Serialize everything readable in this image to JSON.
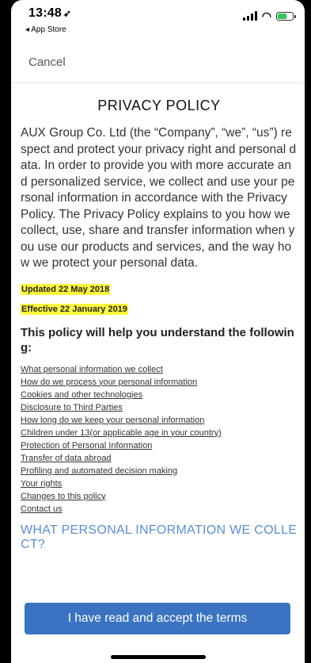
{
  "status_bar": {
    "time": "13:48",
    "location_glyph": "➶",
    "back_app": "◂ App Store",
    "wifi_glyph": "◠"
  },
  "nav": {
    "cancel_label": "Cancel"
  },
  "policy": {
    "title": "PRIVACY POLICY",
    "intro": "AUX Group Co. Ltd (the “Company”, “we”, “us”) respect and protect your privacy right and personal data. In order to provide you with more accurate and personalized service, we collect and use your personal information in accordance with the Privacy Policy. The Privacy Policy explains to you how we collect, use, share and transfer information when you use our products and services, and the way how we protect your personal data.",
    "updated": "Updated 22 May 2018",
    "effective": "Effective 22 January 2019",
    "subhead": "This policy will help you understand the following:",
    "links": [
      "What personal information we collect",
      "How do we process your personal information",
      "Cookies and other technologies",
      "Disclosure to Third Parties",
      "How long do we keep your personal information",
      "Children under 13(or applicable age in your country)",
      "Protection of Personal Information",
      "Transfer of data abroad",
      "Profiling and automated decision making",
      "Your rights",
      "Changes to this policy",
      "Contact us"
    ],
    "section_head": "WHAT PERSONAL INFORMATION WE COLLECT?"
  },
  "footer": {
    "accept_label": "I have read and accept the terms"
  },
  "colors": {
    "accent": "#3a73c2",
    "section_head": "#5a8ed3",
    "highlight": "#fff93b"
  }
}
